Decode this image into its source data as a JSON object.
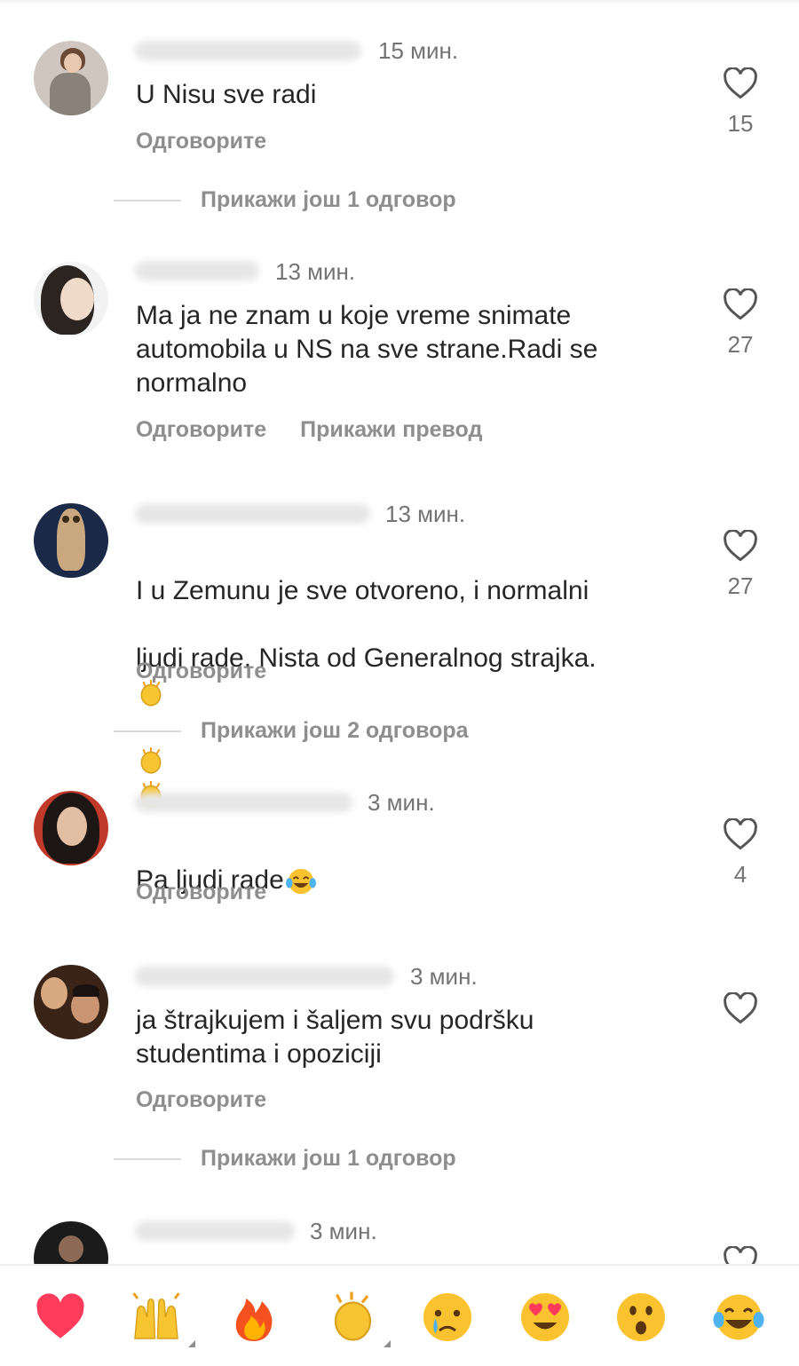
{
  "comments": [
    {
      "time": "15 мин.",
      "text": "U Nisu sve radi",
      "reply": "Одговорите",
      "likes": "15",
      "more_replies": "Прикажи још 1 одговор"
    },
    {
      "time": "13 мин.",
      "text": "Ma ja ne znam u koje vreme snimate\nautomobila u NS na sve strane.Radi se\nnormalno",
      "reply": "Одговорите",
      "translate": "Прикажи превод",
      "likes": "27"
    },
    {
      "time": "13 мин.",
      "text_line1": "I u Zemunu je sve otvoreno, i normalni",
      "text_line2": "ljudi rade. Nista od Generalnog strajka.",
      "reply": "Одговорите",
      "likes": "27",
      "more_replies": "Прикажи још 2 одговора"
    },
    {
      "time": "3 мин.",
      "text": "Pa ljudi rade",
      "reply": "Одговорите",
      "likes": "4"
    },
    {
      "time": "3 мин.",
      "text": "ja štrajkujem i šaljem svu podršku\nstudentima i opoziciji",
      "reply": "Одговорите",
      "more_replies": "Прикажи још 1 одговор"
    },
    {
      "time": "3 мин."
    }
  ],
  "reactions": [
    "red-heart",
    "raising-hands",
    "fire",
    "clapping-hands",
    "crying-face",
    "heart-eyes",
    "surprised-face",
    "tears-of-joy"
  ],
  "colors": {
    "text": "#262626",
    "secondary": "#8e8e8e",
    "time": "#737373",
    "heart": "#ff3b5c"
  }
}
